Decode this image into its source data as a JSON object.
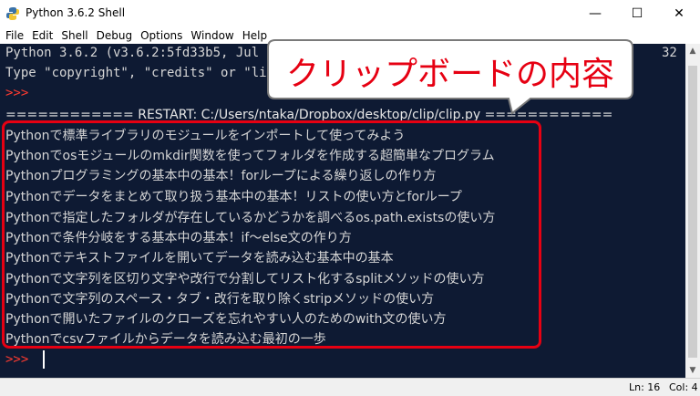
{
  "window": {
    "title": "Python 3.6.2 Shell",
    "minimize_glyph": "—",
    "maximize_glyph": "☐",
    "close_glyph": "✕"
  },
  "menu": [
    "File",
    "Edit",
    "Shell",
    "Debug",
    "Options",
    "Window",
    "Help"
  ],
  "shell": {
    "banner_line1": "Python 3.6.2 (v3.6.2:5fd33b5, Jul  8 20",
    "banner_line1_tail": "32",
    "banner_line2": "Type \"copyright\", \"credits\" or \"license()",
    "prompt": ">>>",
    "restart_line": "============ RESTART: C:/Users/ntaka/Dropbox/desktop/clip/clip.py ============",
    "output_lines": [
      "Pythonで標準ライブラリのモジュールをインポートして使ってみよう",
      "Pythonでosモジュールのmkdir関数を使ってフォルダを作成する超簡単なプログラム",
      "Pythonプログラミングの基本中の基本！forループによる繰り返しの作り方",
      "Pythonでデータをまとめて取り扱う基本中の基本！リストの使い方とforループ",
      "Pythonで指定したフォルダが存在しているかどうかを調べるos.path.existsの使い方",
      "Pythonで条件分岐をする基本中の基本！if〜else文の作り方",
      "Pythonでテキストファイルを開いてデータを読み込む基本中の基本",
      "Pythonで文字列を区切り文字や改行で分割してリスト化するsplitメソッドの使い方",
      "Pythonで文字列のスペース・タブ・改行を取り除くstripメソッドの使い方",
      "Pythonで開いたファイルのクローズを忘れやすい人のためのwith文の使い方",
      "Pythonでcsvファイルからデータを読み込む最初の一歩"
    ]
  },
  "callout": {
    "text": "クリップボードの内容"
  },
  "statusbar": {
    "line": "Ln: 16",
    "col": "Col: 4"
  },
  "colors": {
    "shell_bg": "#0e1a33",
    "prompt": "#ff3b30",
    "highlight": "#e60012"
  }
}
